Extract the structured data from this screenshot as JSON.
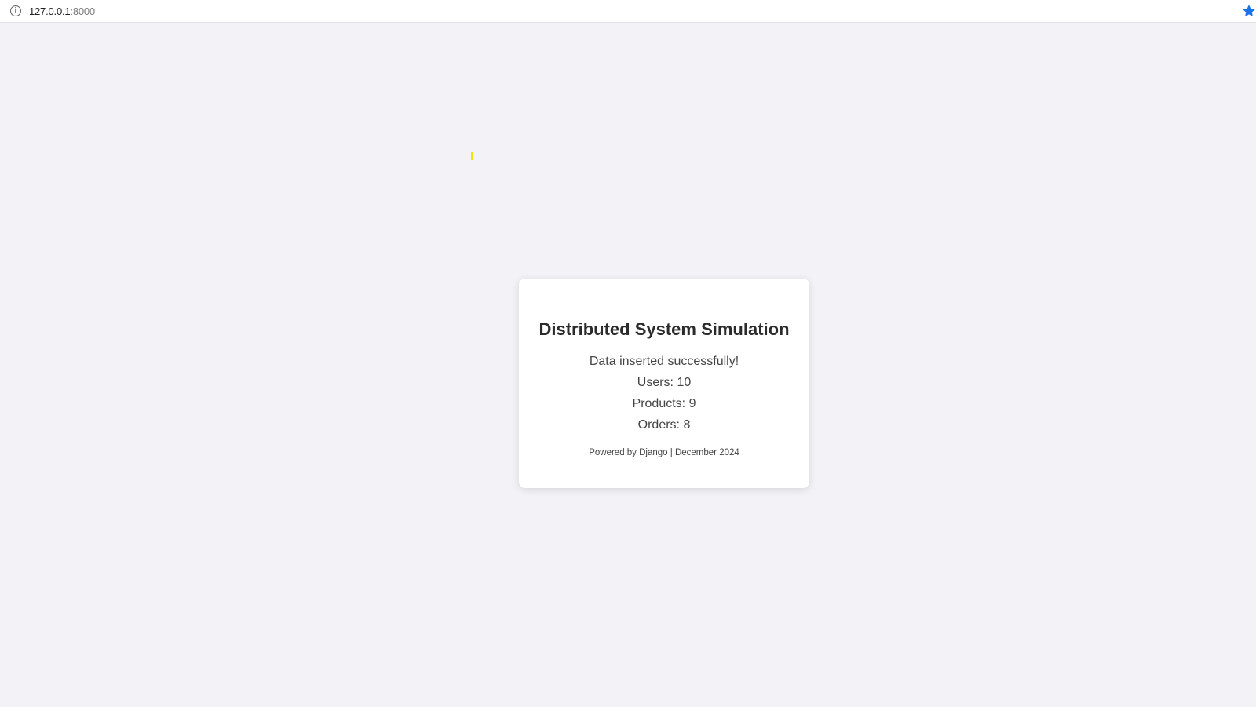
{
  "browser": {
    "url_host": "127.0.0.1",
    "url_port": ":8000",
    "info_icon": "info-icon",
    "bookmark_icon": "star-icon",
    "bookmark_color": "#1a73e8"
  },
  "card": {
    "title": "Distributed System Simulation",
    "message": "Data inserted successfully!",
    "users": "Users: 10",
    "products": "Products: 9",
    "orders": "Orders: 8",
    "footer": "Powered by Django | December 2024"
  },
  "colors": {
    "page_background": "#f3f3f7",
    "card_background": "#ffffff",
    "title_text": "#2b2b2b",
    "body_text": "#444444"
  }
}
